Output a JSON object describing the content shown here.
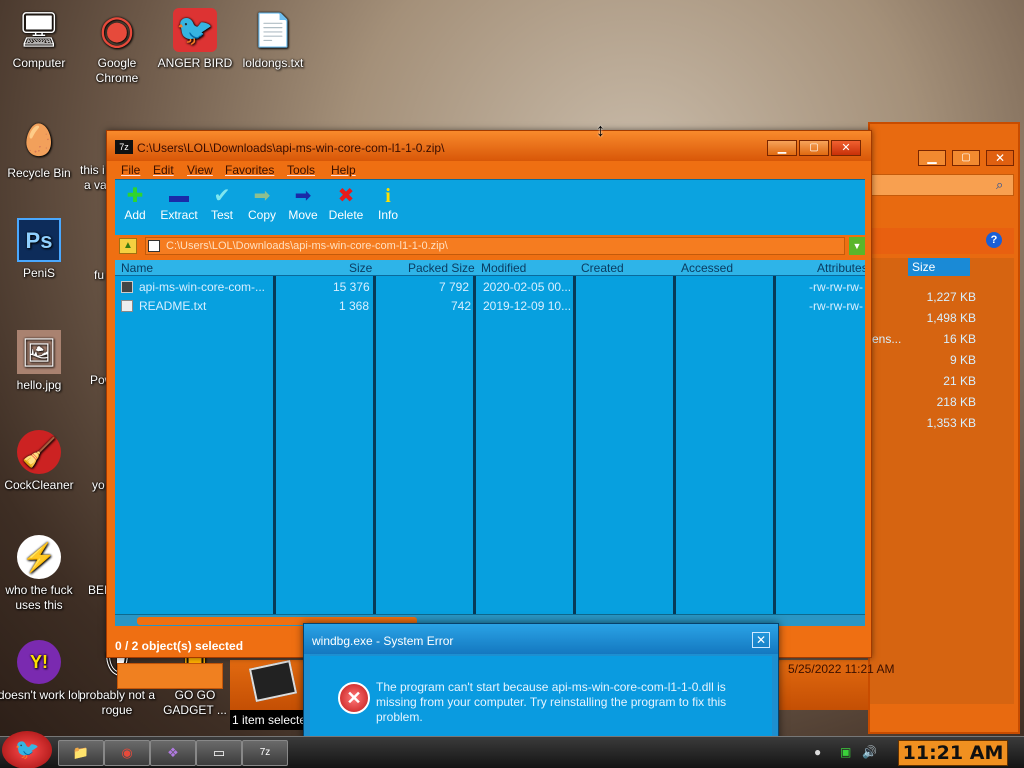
{
  "desktop": {
    "icons": [
      {
        "label": "Computer",
        "icon": "computer-icon",
        "glyph": "🖥"
      },
      {
        "label": "Google Chrome",
        "icon": "chrome-icon",
        "glyph": "◉"
      },
      {
        "label": "ANGER BIRD",
        "icon": "angry-bird-icon",
        "glyph": "🐦"
      },
      {
        "label": "loldongs.txt",
        "icon": "text-file-icon",
        "glyph": "📄"
      },
      {
        "label": "Recycle Bin",
        "icon": "recycle-bin-icon",
        "glyph": "🥚"
      },
      {
        "label": "PeniS",
        "icon": "photoshop-icon",
        "glyph": "Ps"
      },
      {
        "label": "hello.jpg",
        "icon": "image-file-icon",
        "glyph": "🖼"
      },
      {
        "label": "CockCleaner",
        "icon": "ccleaner-icon",
        "glyph": "🧹"
      },
      {
        "label": "who the fuck uses this",
        "icon": "winamp-icon",
        "glyph": "⚡"
      },
      {
        "label": "doesn't work lol",
        "icon": "yahoo-messenger-icon",
        "glyph": "Y!"
      },
      {
        "label": "probably not a rogue",
        "icon": "rogue-antivirus-icon",
        "glyph": "🛡"
      },
      {
        "label": "GO GO GADGET ...",
        "icon": "gadget-icon",
        "glyph": "▣"
      }
    ],
    "partial_labels": [
      "this i",
      "a va",
      "fu",
      "Pow",
      "yo",
      "BEE"
    ]
  },
  "zip_window": {
    "title": "C:\\Users\\LOL\\Downloads\\api-ms-win-core-com-l1-1-0.zip\\",
    "app_icon": "7z",
    "menu": [
      "File",
      "Edit",
      "View",
      "Favorites",
      "Tools",
      "Help"
    ],
    "toolbar": [
      {
        "label": "Add",
        "icon": "add-icon",
        "glyph": "✚",
        "color": "#2fd42f"
      },
      {
        "label": "Extract",
        "icon": "extract-icon",
        "glyph": "▬",
        "color": "#1a2aa8"
      },
      {
        "label": "Test",
        "icon": "test-icon",
        "glyph": "✔",
        "color": "#7fe6ef"
      },
      {
        "label": "Copy",
        "icon": "copy-icon",
        "glyph": "➡",
        "color": "#8fbf8f"
      },
      {
        "label": "Move",
        "icon": "move-icon",
        "glyph": "➡",
        "color": "#1a2aa8"
      },
      {
        "label": "Delete",
        "icon": "delete-icon",
        "glyph": "✖",
        "color": "#e81b1b"
      },
      {
        "label": "Info",
        "icon": "info-icon",
        "glyph": "i",
        "color": "#ffe000"
      }
    ],
    "address": "C:\\Users\\LOL\\Downloads\\api-ms-win-core-com-l1-1-0.zip\\",
    "columns": [
      "Name",
      "Size",
      "Packed Size",
      "Modified",
      "Created",
      "Accessed",
      "Attributes"
    ],
    "files": [
      {
        "name": "api-ms-win-core-com-...",
        "size": "15 376",
        "packed": "7 792",
        "modified": "2020-02-05 00...",
        "created": "",
        "accessed": "",
        "attributes": "-rw-rw-rw-"
      },
      {
        "name": "README.txt",
        "size": "1 368",
        "packed": "742",
        "modified": "2019-12-09 10...",
        "created": "",
        "accessed": "",
        "attributes": "-rw-rw-rw-"
      }
    ],
    "status": "0 / 2 object(s) selected"
  },
  "back_window": {
    "size_header": "Size",
    "sizes": [
      "1,227 KB",
      "1,498 KB",
      "16 KB",
      "9 KB",
      "21 KB",
      "218 KB",
      "1,353 KB"
    ],
    "fragment": "ens...",
    "details": "5/25/2022 11:21 AM",
    "selection": "1 item selecte"
  },
  "error_dialog": {
    "title": "windbg.exe - System Error",
    "close": "✕",
    "message": "The program can't start because api-ms-win-core-com-l1-1-0.dll is missing from your computer. Try reinstalling the program to fix this problem."
  },
  "taskbar": {
    "clock": "11:21 AM",
    "items": [
      {
        "icon": "explorer-icon",
        "glyph": "📁"
      },
      {
        "icon": "chrome-icon",
        "glyph": "◉"
      },
      {
        "icon": "app-icon",
        "glyph": "❖"
      },
      {
        "icon": "window-icon",
        "glyph": "▭"
      },
      {
        "icon": "7zip-icon",
        "glyph": "7z"
      }
    ]
  }
}
